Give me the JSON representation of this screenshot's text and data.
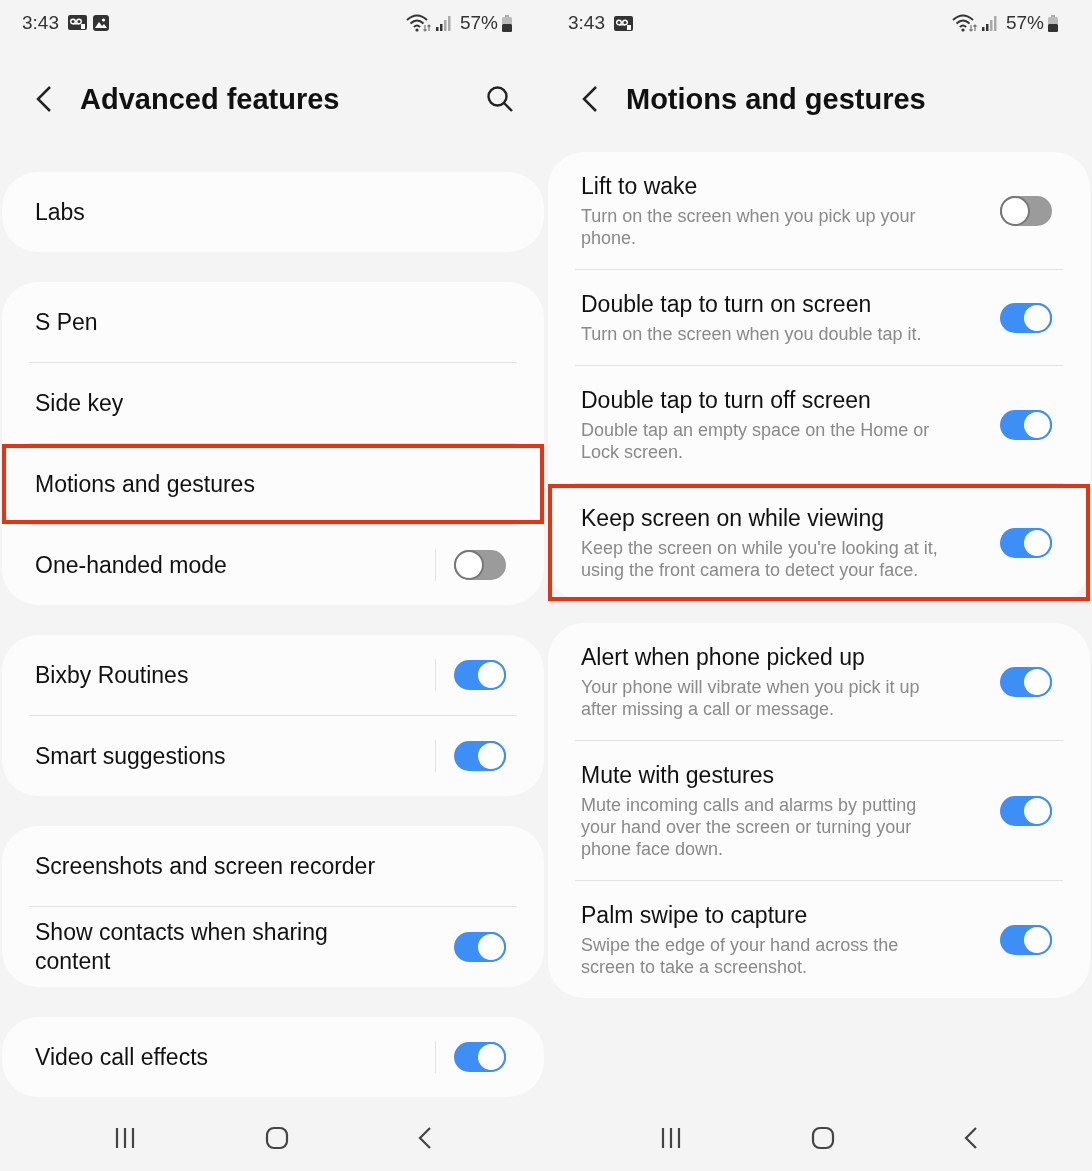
{
  "screens": [
    {
      "status_bar": {
        "time": "3:43",
        "voicemail": true,
        "image": true,
        "battery": "57%"
      },
      "header": {
        "title": "Advanced features",
        "search": true
      },
      "groups": [
        {
          "items": [
            {
              "kind": "link",
              "label": "Labs",
              "highlighted": false
            }
          ]
        },
        {
          "items": [
            {
              "kind": "link",
              "label": "S Pen",
              "highlighted": false
            },
            {
              "kind": "link",
              "label": "Side key",
              "highlighted": false
            },
            {
              "kind": "link",
              "label": "Motions and gestures",
              "highlighted": true
            },
            {
              "kind": "switch-link",
              "label": "One-handed mode",
              "on": false,
              "highlighted": false
            }
          ]
        },
        {
          "items": [
            {
              "kind": "switch-link",
              "label": "Bixby Routines",
              "on": true,
              "highlighted": false
            },
            {
              "kind": "switch-link",
              "label": "Smart suggestions",
              "on": true,
              "highlighted": false
            }
          ]
        },
        {
          "items": [
            {
              "kind": "link",
              "label": "Screenshots and screen recorder",
              "highlighted": false
            },
            {
              "kind": "switch",
              "label": "Show contacts when sharing content",
              "on": true,
              "highlighted": false
            }
          ]
        },
        {
          "items": [
            {
              "kind": "switch-link",
              "label": "Video call effects",
              "on": true,
              "highlighted": false
            }
          ]
        }
      ]
    },
    {
      "status_bar": {
        "time": "3:43",
        "voicemail": true,
        "battery": "57%"
      },
      "header": {
        "title": "Motions and gestures"
      },
      "groups": [
        {
          "items": [
            {
              "kind": "switch",
              "label": "Lift to wake",
              "description": "Turn on the screen when you pick up your phone.",
              "on": false,
              "highlighted": false
            },
            {
              "kind": "switch",
              "label": "Double tap to turn on screen",
              "description": "Turn on the screen when you double tap it.",
              "on": true,
              "highlighted": false
            },
            {
              "kind": "switch",
              "label": "Double tap to turn off screen",
              "description": "Double tap an empty space on the Home or Lock screen.",
              "on": true,
              "highlighted": false
            },
            {
              "kind": "switch",
              "label": "Keep screen on while viewing",
              "description": "Keep the screen on while you're looking at it, using the front camera to detect your face.",
              "on": true,
              "highlighted": true
            }
          ]
        },
        {
          "items": [
            {
              "kind": "switch",
              "label": "Alert when phone picked up",
              "description": "Your phone will vibrate when you pick it up after missing a call or message.",
              "on": true,
              "highlighted": false
            },
            {
              "kind": "switch",
              "label": "Mute with gestures",
              "description": "Mute incoming calls and alarms by putting your hand over the screen or turning your phone face down.",
              "on": true,
              "highlighted": false
            },
            {
              "kind": "switch",
              "label": "Palm swipe to capture",
              "description": "Swipe the edge of your hand across the screen to take a screenshot.",
              "on": true,
              "highlighted": false
            }
          ]
        }
      ]
    }
  ]
}
